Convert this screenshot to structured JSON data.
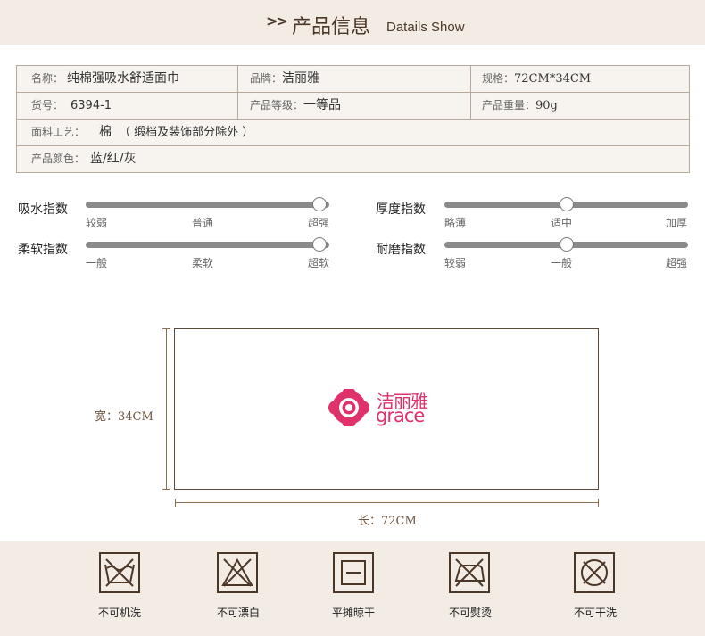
{
  "header": {
    "arrows": ">>",
    "title": "产品信息",
    "subtitle": "Datails Show"
  },
  "info": {
    "name_label": "名称：",
    "name_value": "纯棉强吸水舒适面巾",
    "brand_label": "品牌：",
    "brand_value": "洁丽雅",
    "spec_label": "规格：",
    "spec_value": "72CM*34CM",
    "sku_label": "货号：",
    "sku_value": "6394-1",
    "grade_label": "产品等级：",
    "grade_value": "一等品",
    "weight_label": "产品重量：",
    "weight_value": "90g",
    "fabric_label": "面料工艺：",
    "fabric_value": "棉",
    "fabric_note": "（ 缎档及装饰部分除外 ）",
    "color_label": "产品颜色：",
    "color_blue": "蓝",
    "color_rest": "/红/灰"
  },
  "indices": {
    "absorb": {
      "label": "吸水指数",
      "ticks": [
        "较弱",
        "普通",
        "超强"
      ],
      "level": 1.0
    },
    "thickness": {
      "label": "厚度指数",
      "ticks": [
        "略薄",
        "适中",
        "加厚"
      ],
      "level": 0.5
    },
    "softness": {
      "label": "柔软指数",
      "ticks": [
        "一般",
        "柔软",
        "超软"
      ],
      "level": 1.0
    },
    "durability": {
      "label": "耐磨指数",
      "ticks": [
        "较弱",
        "一般",
        "超强"
      ],
      "level": 0.5
    }
  },
  "size": {
    "width_label": "宽：",
    "width_value": "34CM",
    "length_label": "长：",
    "length_value": "72CM",
    "logo_cn": "洁丽雅",
    "logo_en": "grace"
  },
  "care": [
    {
      "label": "不可机洗",
      "icon": "no-machine-wash-icon"
    },
    {
      "label": "不可漂白",
      "icon": "no-bleach-icon"
    },
    {
      "label": "平摊晾干",
      "icon": "dry-flat-icon"
    },
    {
      "label": "不可熨烫",
      "icon": "no-iron-icon"
    },
    {
      "label": "不可干洗",
      "icon": "no-dry-clean-icon"
    }
  ],
  "colors": {
    "header_bg": "#f3ece5",
    "brown": "#4a3728",
    "brand_pink": "#e0316a",
    "blue_text": "#1a3c9c"
  }
}
